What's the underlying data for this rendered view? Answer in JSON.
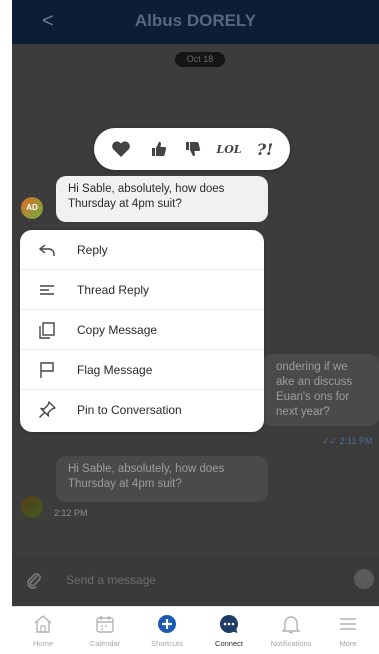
{
  "header": {
    "back_glyph": "<",
    "title": "Albus DORELY"
  },
  "chat": {
    "date_label": "Oct 18",
    "messages": [
      {
        "avatar": "AD",
        "text": "Hi Sable, absolutely, how does Thursday at 4pm suit?"
      },
      {
        "text": "ondering if we ake an discuss Euan's ons for next year?",
        "time": "2:11 PM"
      },
      {
        "avatar": "AD",
        "text": "Hi Sable, absolutely, how does Thursday at 4pm suit?",
        "time": "2:12 PM"
      }
    ],
    "input_placeholder": "Send a message"
  },
  "reactions": {
    "items": [
      "heart-icon",
      "thumbs-up-icon",
      "thumbs-down-icon",
      "lol-icon",
      "question-exclamation-icon"
    ],
    "lol_text": "LOL",
    "question_text": "?!"
  },
  "menu": {
    "items": [
      {
        "icon": "reply-icon",
        "label": "Reply"
      },
      {
        "icon": "thread-icon",
        "label": "Thread Reply"
      },
      {
        "icon": "copy-icon",
        "label": "Copy Message"
      },
      {
        "icon": "flag-icon",
        "label": "Flag Message"
      },
      {
        "icon": "pin-icon",
        "label": "Pin to Conversation"
      }
    ]
  },
  "tabbar": {
    "tabs": [
      {
        "icon": "home-icon",
        "label": "Home"
      },
      {
        "icon": "calendar-icon",
        "label": "Calendar"
      },
      {
        "icon": "plus-circle-icon",
        "label": "Shortcuts"
      },
      {
        "icon": "chat-bubble-icon",
        "label": "Connect",
        "active": true
      },
      {
        "icon": "bell-icon",
        "label": "Notifications"
      },
      {
        "icon": "menu-icon",
        "label": "More"
      }
    ]
  },
  "colors": {
    "header_bg": "#0d1d35",
    "overlay": "#3c3c3c",
    "accent": "#1b5bb5",
    "connect_active": "#1e3a66"
  }
}
